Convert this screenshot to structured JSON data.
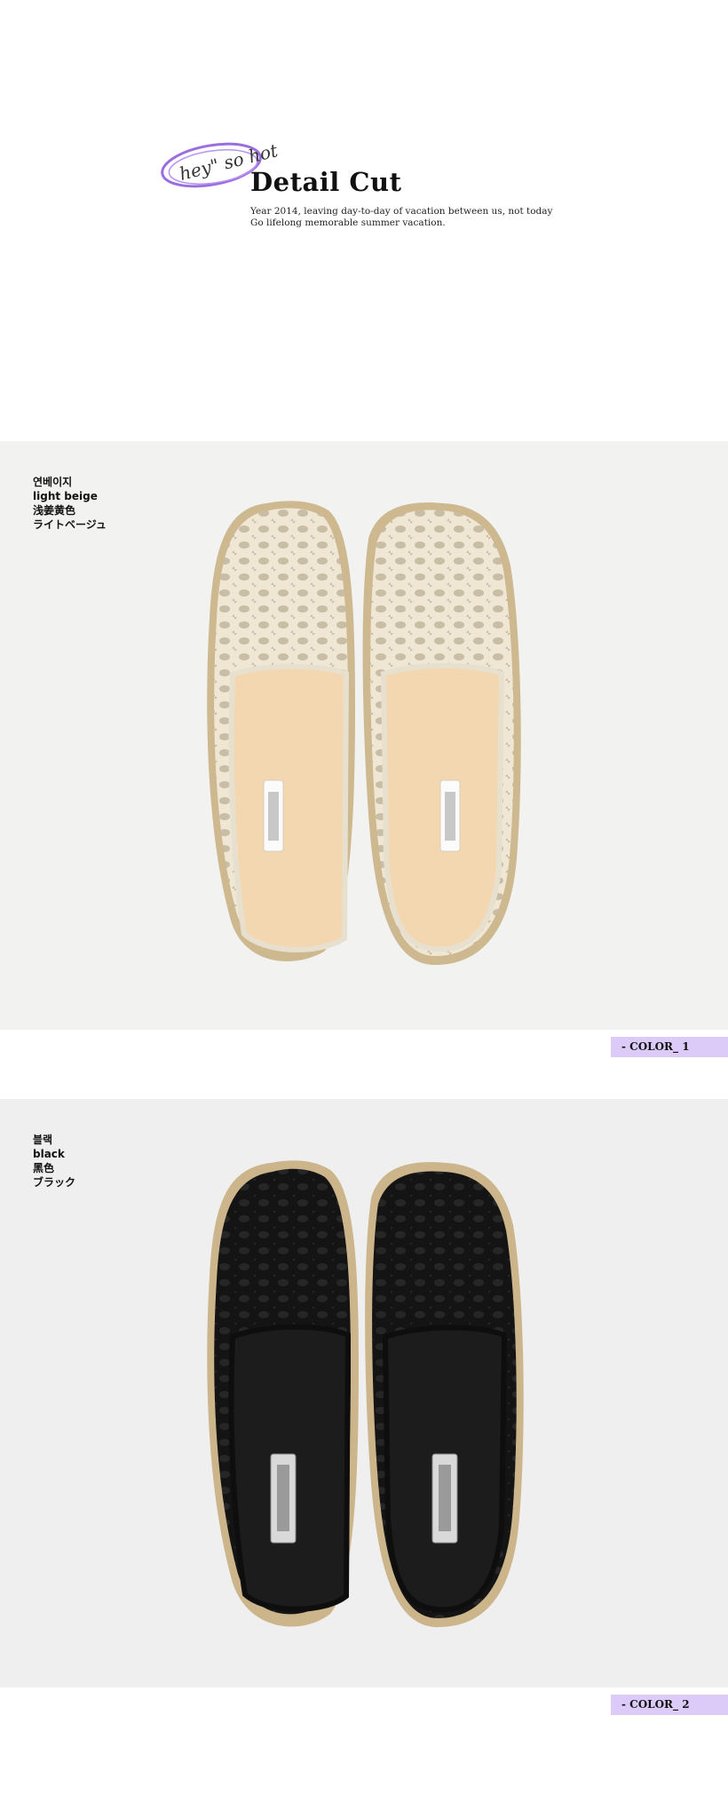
{
  "header": {
    "script_text": "hey\" so hot",
    "title": "Detail Cut",
    "subtitle_line1": "Year 2014, leaving day-to-day of vacation between us, not today",
    "subtitle_line2": "Go lifelong memorable summer vacation."
  },
  "colors": [
    {
      "labels": [
        "연베이지",
        "light beige",
        "浅姜黄色",
        "ライトベージュ"
      ],
      "tag": "- COLOR_ 1",
      "swatch": "#e9e0cc"
    },
    {
      "labels": [
        "블랙",
        "black",
        "黑色",
        "ブラック"
      ],
      "tag": "- COLOR_ 2",
      "swatch": "#161616"
    }
  ],
  "accent": "#dccbf8"
}
